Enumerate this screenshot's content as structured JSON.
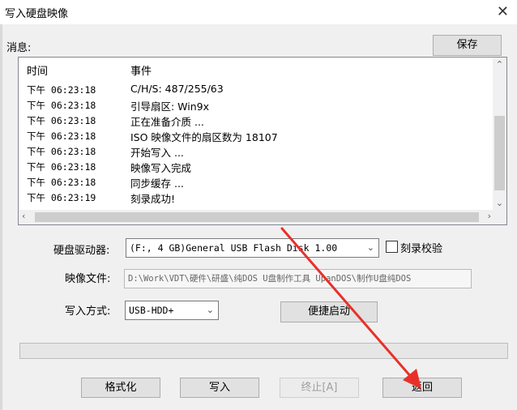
{
  "window": {
    "title": "写入硬盘映像",
    "close_glyph": "✕"
  },
  "messages": {
    "label": "消息:",
    "save_label": "保存",
    "columns": {
      "time": "时间",
      "event": "事件"
    },
    "rows": [
      {
        "time": "下午 06:23:18",
        "event": "C/H/S: 487/255/63"
      },
      {
        "time": "下午 06:23:18",
        "event": "引导扇区: Win9x"
      },
      {
        "time": "下午 06:23:18",
        "event": "正在准备介质 ..."
      },
      {
        "time": "下午 06:23:18",
        "event": "ISO 映像文件的扇区数为 18107"
      },
      {
        "time": "下午 06:23:18",
        "event": "开始写入 ..."
      },
      {
        "time": "下午 06:23:18",
        "event": "映像写入完成"
      },
      {
        "time": "下午 06:23:18",
        "event": "同步缓存 ..."
      },
      {
        "time": "下午 06:23:19",
        "event": "刻录成功!"
      }
    ]
  },
  "drive": {
    "label": "硬盘驱动器:",
    "value": "(F:, 4 GB)General USB Flash Disk  1.00"
  },
  "verify": {
    "label": "刻录校验",
    "checked": false
  },
  "image_file": {
    "label": "映像文件:",
    "value": "D:\\Work\\VDT\\硬件\\研盛\\纯DOS U盘制作工具 UpanDOS\\制作U盘纯DOS"
  },
  "write_method": {
    "label": "写入方式:",
    "value": "USB-HDD+"
  },
  "quick_boot_label": "便捷启动",
  "progress_fraction": 0,
  "buttons": {
    "format": "格式化",
    "write": "写入",
    "abort": "终止[A]",
    "back": "返回"
  },
  "colors": {
    "annotation_arrow": "#e8302a"
  }
}
